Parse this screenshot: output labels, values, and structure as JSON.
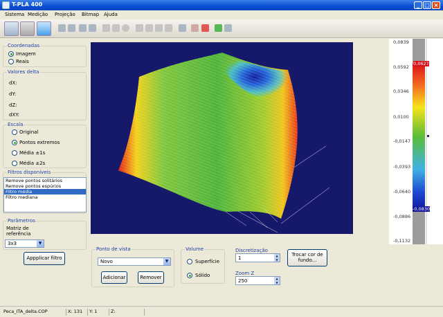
{
  "window": {
    "title": "T-PLA 400"
  },
  "menu": [
    "Sistema",
    "Medição",
    "Projeção",
    "Bitmap",
    "Ajuda"
  ],
  "coordenadas": {
    "title": "Coordenadas",
    "options": [
      "Imagem",
      "Reais"
    ],
    "selected": "Imagem"
  },
  "valores_delta": {
    "title": "Valores delta",
    "labels": [
      "dX:",
      "dY:",
      "dZ:",
      "dXY:"
    ]
  },
  "escala": {
    "title": "Escala",
    "options": [
      "Original",
      "Pontos extremos",
      "Média ±1s",
      "Média ±2s"
    ],
    "selected": "Pontos extremos"
  },
  "filtros": {
    "title": "Filtros disponíveis",
    "items": [
      "Remove pontos solitários",
      "Remove pontos espúrios",
      "Filtro média",
      "Filtro mediana"
    ],
    "selected": "Filtro média"
  },
  "parametros": {
    "title": "Parâmetros",
    "matrix_label_1": "Matriz de",
    "matrix_label_2": "referência",
    "matrix_value": "3x3"
  },
  "apply_button": "Appplicar filtro",
  "ponto_de_vista": {
    "title": "Ponto de vista",
    "value": "Novo",
    "add": "Adicionar",
    "remove": "Remover"
  },
  "volume": {
    "title": "Volume",
    "options": [
      "Superfície",
      "Sólido"
    ],
    "selected": "Sólido"
  },
  "discretizacao": {
    "title": "Discretização",
    "value": "1"
  },
  "zoom": {
    "title": "Zoom Z",
    "value": "250"
  },
  "background_button": {
    "line1": "Trocar cor de",
    "line2": "fundo..."
  },
  "scale": {
    "ticks": [
      "0,0839",
      "0,0592",
      "0,0346",
      "0,0100",
      "-0,0147",
      "-0,0393",
      "-0,0640",
      "-0,0886",
      "-0,1132"
    ],
    "max_marker": "0,0627",
    "min_marker": "-0,0830"
  },
  "status": {
    "file": "Peca_ITA_delta.COP",
    "x": "X: 131",
    "y": "Y: 1",
    "z": "Z:"
  }
}
